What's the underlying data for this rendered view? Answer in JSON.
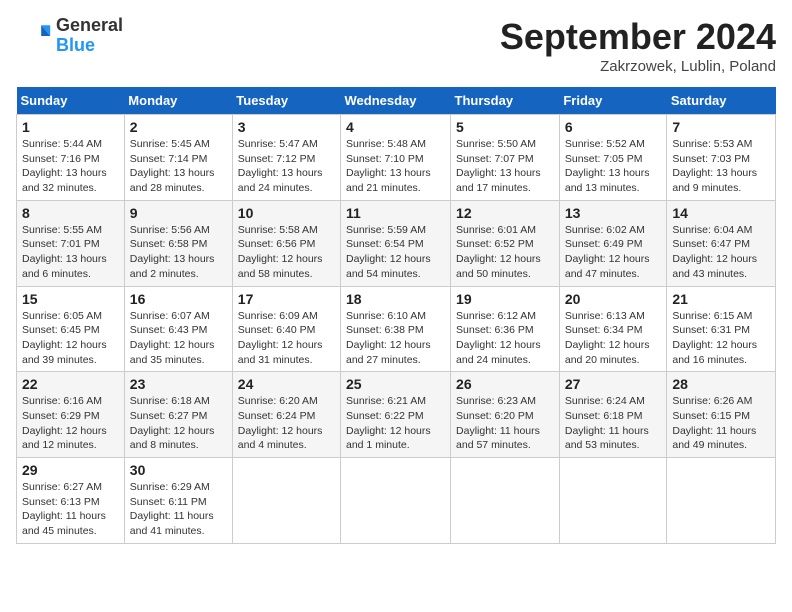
{
  "header": {
    "logo_line1": "General",
    "logo_line2": "Blue",
    "title": "September 2024",
    "subtitle": "Zakrzowek, Lublin, Poland"
  },
  "weekdays": [
    "Sunday",
    "Monday",
    "Tuesday",
    "Wednesday",
    "Thursday",
    "Friday",
    "Saturday"
  ],
  "weeks": [
    [
      {
        "day": "1",
        "detail": "Sunrise: 5:44 AM\nSunset: 7:16 PM\nDaylight: 13 hours\nand 32 minutes."
      },
      {
        "day": "2",
        "detail": "Sunrise: 5:45 AM\nSunset: 7:14 PM\nDaylight: 13 hours\nand 28 minutes."
      },
      {
        "day": "3",
        "detail": "Sunrise: 5:47 AM\nSunset: 7:12 PM\nDaylight: 13 hours\nand 24 minutes."
      },
      {
        "day": "4",
        "detail": "Sunrise: 5:48 AM\nSunset: 7:10 PM\nDaylight: 13 hours\nand 21 minutes."
      },
      {
        "day": "5",
        "detail": "Sunrise: 5:50 AM\nSunset: 7:07 PM\nDaylight: 13 hours\nand 17 minutes."
      },
      {
        "day": "6",
        "detail": "Sunrise: 5:52 AM\nSunset: 7:05 PM\nDaylight: 13 hours\nand 13 minutes."
      },
      {
        "day": "7",
        "detail": "Sunrise: 5:53 AM\nSunset: 7:03 PM\nDaylight: 13 hours\nand 9 minutes."
      }
    ],
    [
      {
        "day": "8",
        "detail": "Sunrise: 5:55 AM\nSunset: 7:01 PM\nDaylight: 13 hours\nand 6 minutes."
      },
      {
        "day": "9",
        "detail": "Sunrise: 5:56 AM\nSunset: 6:58 PM\nDaylight: 13 hours\nand 2 minutes."
      },
      {
        "day": "10",
        "detail": "Sunrise: 5:58 AM\nSunset: 6:56 PM\nDaylight: 12 hours\nand 58 minutes."
      },
      {
        "day": "11",
        "detail": "Sunrise: 5:59 AM\nSunset: 6:54 PM\nDaylight: 12 hours\nand 54 minutes."
      },
      {
        "day": "12",
        "detail": "Sunrise: 6:01 AM\nSunset: 6:52 PM\nDaylight: 12 hours\nand 50 minutes."
      },
      {
        "day": "13",
        "detail": "Sunrise: 6:02 AM\nSunset: 6:49 PM\nDaylight: 12 hours\nand 47 minutes."
      },
      {
        "day": "14",
        "detail": "Sunrise: 6:04 AM\nSunset: 6:47 PM\nDaylight: 12 hours\nand 43 minutes."
      }
    ],
    [
      {
        "day": "15",
        "detail": "Sunrise: 6:05 AM\nSunset: 6:45 PM\nDaylight: 12 hours\nand 39 minutes."
      },
      {
        "day": "16",
        "detail": "Sunrise: 6:07 AM\nSunset: 6:43 PM\nDaylight: 12 hours\nand 35 minutes."
      },
      {
        "day": "17",
        "detail": "Sunrise: 6:09 AM\nSunset: 6:40 PM\nDaylight: 12 hours\nand 31 minutes."
      },
      {
        "day": "18",
        "detail": "Sunrise: 6:10 AM\nSunset: 6:38 PM\nDaylight: 12 hours\nand 27 minutes."
      },
      {
        "day": "19",
        "detail": "Sunrise: 6:12 AM\nSunset: 6:36 PM\nDaylight: 12 hours\nand 24 minutes."
      },
      {
        "day": "20",
        "detail": "Sunrise: 6:13 AM\nSunset: 6:34 PM\nDaylight: 12 hours\nand 20 minutes."
      },
      {
        "day": "21",
        "detail": "Sunrise: 6:15 AM\nSunset: 6:31 PM\nDaylight: 12 hours\nand 16 minutes."
      }
    ],
    [
      {
        "day": "22",
        "detail": "Sunrise: 6:16 AM\nSunset: 6:29 PM\nDaylight: 12 hours\nand 12 minutes."
      },
      {
        "day": "23",
        "detail": "Sunrise: 6:18 AM\nSunset: 6:27 PM\nDaylight: 12 hours\nand 8 minutes."
      },
      {
        "day": "24",
        "detail": "Sunrise: 6:20 AM\nSunset: 6:24 PM\nDaylight: 12 hours\nand 4 minutes."
      },
      {
        "day": "25",
        "detail": "Sunrise: 6:21 AM\nSunset: 6:22 PM\nDaylight: 12 hours\nand 1 minute."
      },
      {
        "day": "26",
        "detail": "Sunrise: 6:23 AM\nSunset: 6:20 PM\nDaylight: 11 hours\nand 57 minutes."
      },
      {
        "day": "27",
        "detail": "Sunrise: 6:24 AM\nSunset: 6:18 PM\nDaylight: 11 hours\nand 53 minutes."
      },
      {
        "day": "28",
        "detail": "Sunrise: 6:26 AM\nSunset: 6:15 PM\nDaylight: 11 hours\nand 49 minutes."
      }
    ],
    [
      {
        "day": "29",
        "detail": "Sunrise: 6:27 AM\nSunset: 6:13 PM\nDaylight: 11 hours\nand 45 minutes."
      },
      {
        "day": "30",
        "detail": "Sunrise: 6:29 AM\nSunset: 6:11 PM\nDaylight: 11 hours\nand 41 minutes."
      },
      {
        "day": "",
        "detail": ""
      },
      {
        "day": "",
        "detail": ""
      },
      {
        "day": "",
        "detail": ""
      },
      {
        "day": "",
        "detail": ""
      },
      {
        "day": "",
        "detail": ""
      }
    ]
  ]
}
